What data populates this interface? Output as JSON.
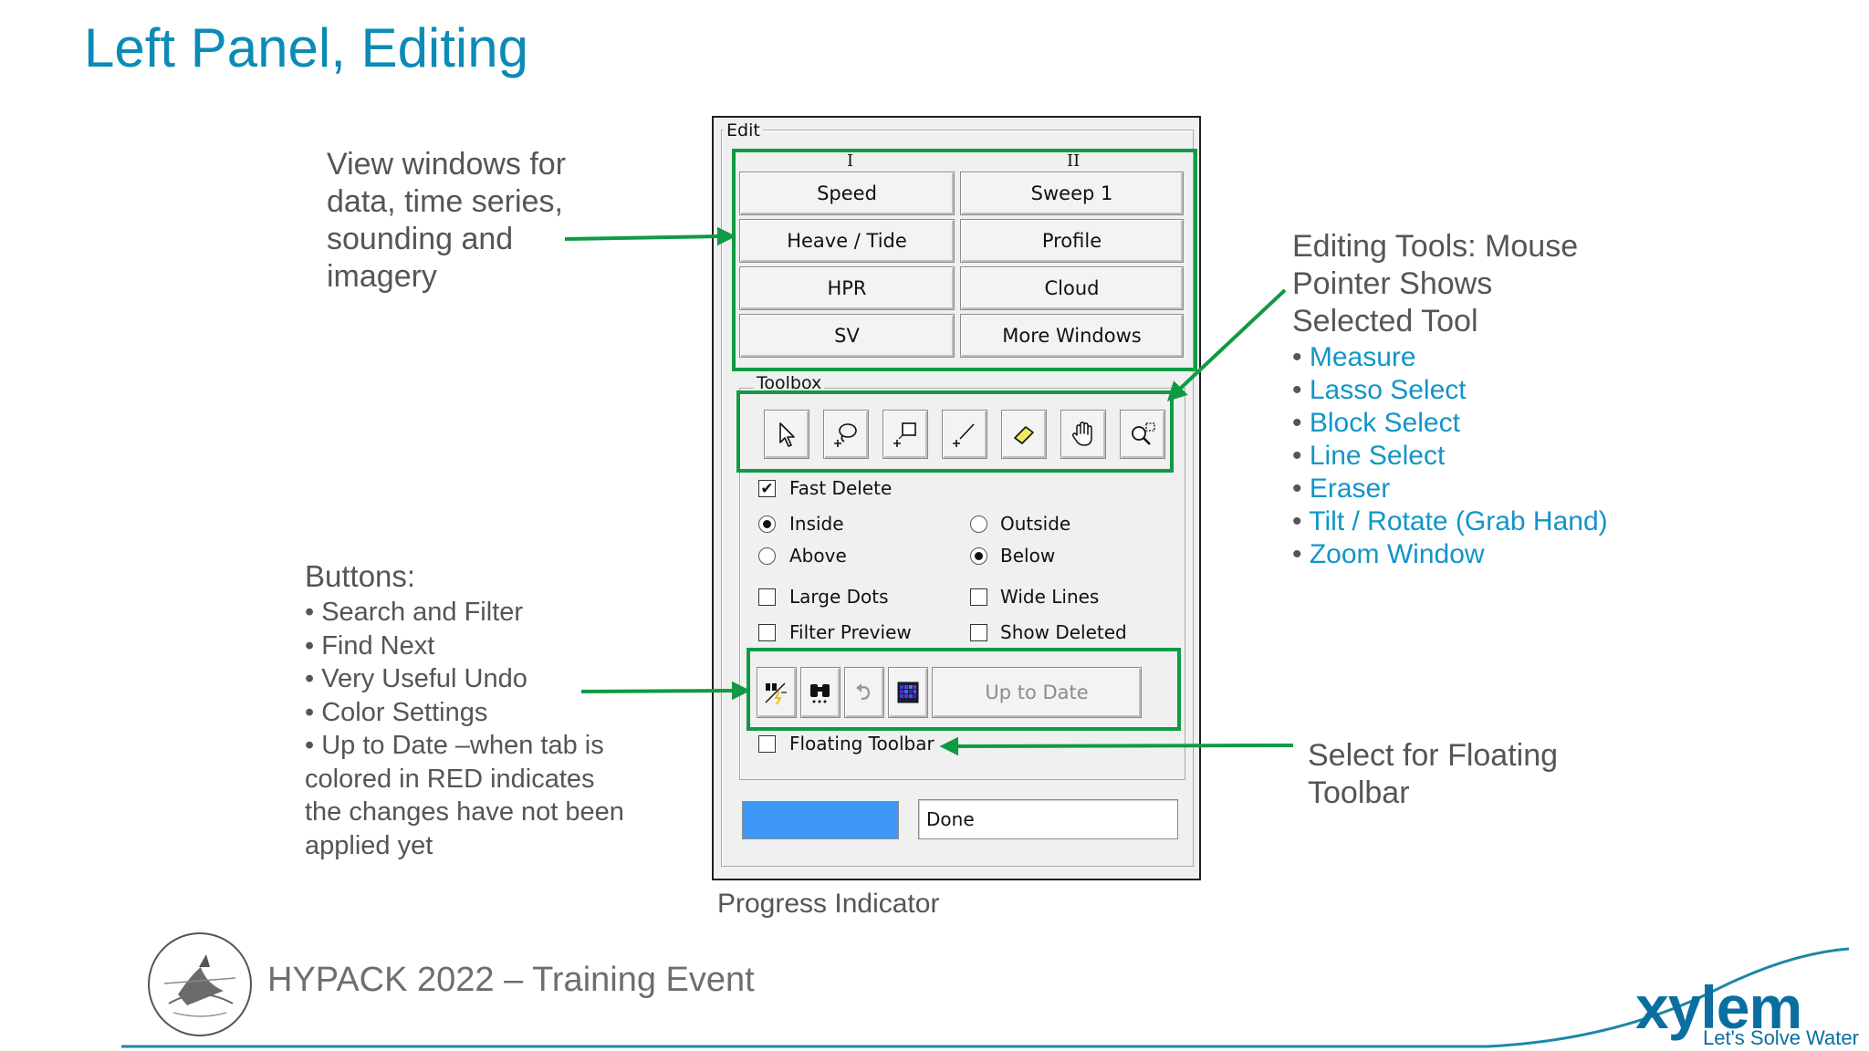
{
  "slide": {
    "title": "Left Panel, Editing",
    "footer": "HYPACK 2022 – Training Event",
    "brand": "xylem",
    "tagline": "Let's Solve Water",
    "progress_caption": "Progress Indicator"
  },
  "notes": {
    "view_windows": [
      "View windows for",
      "data, time series,",
      "sounding and",
      "imagery"
    ],
    "editing_tools": {
      "heading": [
        "Editing Tools:  Mouse",
        "Pointer Shows",
        "Selected Tool"
      ],
      "items": [
        "Measure",
        "Lasso Select",
        "Block Select",
        "Line Select",
        "Eraser",
        "Tilt / Rotate (Grab Hand)",
        "Zoom Window"
      ]
    },
    "buttons": {
      "heading": "Buttons:",
      "items": [
        "• Search and Filter",
        "• Find Next",
        "• Very Useful Undo",
        "• Color Settings",
        "• Up to Date –when tab is",
        "colored in RED indicates",
        "the changes have not been",
        "applied yet"
      ]
    },
    "floating": [
      "Select for Floating",
      "Toolbar"
    ]
  },
  "dialog": {
    "group_label": "Edit",
    "col1_header": "I",
    "col2_header": "II",
    "windows_col1": [
      "Speed",
      "Heave / Tide",
      "HPR",
      "SV"
    ],
    "windows_col2": [
      "Sweep 1",
      "Profile",
      "Cloud",
      "More Windows"
    ],
    "toolbox_label": "Toolbox",
    "tools": [
      "pointer-icon",
      "lasso-icon",
      "block-select-icon",
      "line-select-icon",
      "eraser-icon",
      "grab-hand-icon",
      "zoom-window-icon"
    ],
    "fast_delete": {
      "label": "Fast Delete",
      "checked": true
    },
    "radio_inside": {
      "label": "Inside",
      "selected": true
    },
    "radio_outside": {
      "label": "Outside",
      "selected": false
    },
    "radio_above": {
      "label": "Above",
      "selected": false
    },
    "radio_below": {
      "label": "Below",
      "selected": true
    },
    "large_dots": {
      "label": "Large Dots",
      "checked": false
    },
    "wide_lines": {
      "label": "Wide Lines",
      "checked": false
    },
    "filter_preview": {
      "label": "Filter Preview",
      "checked": false
    },
    "show_deleted": {
      "label": "Show Deleted",
      "checked": false
    },
    "action_icons": [
      "search-filter-icon",
      "find-next-icon",
      "undo-icon",
      "color-settings-icon"
    ],
    "up_to_date": "Up to Date",
    "floating_toolbar": {
      "label": "Floating Toolbar",
      "checked": false
    },
    "progress_fill": 1.0,
    "progress_color": "#3d98f7",
    "status_text": "Done"
  },
  "colors": {
    "title": "#0b8bb5",
    "highlight": "#109a44",
    "bullet_blue": "#1295c8",
    "brand_blue": "#0a6ea0"
  }
}
